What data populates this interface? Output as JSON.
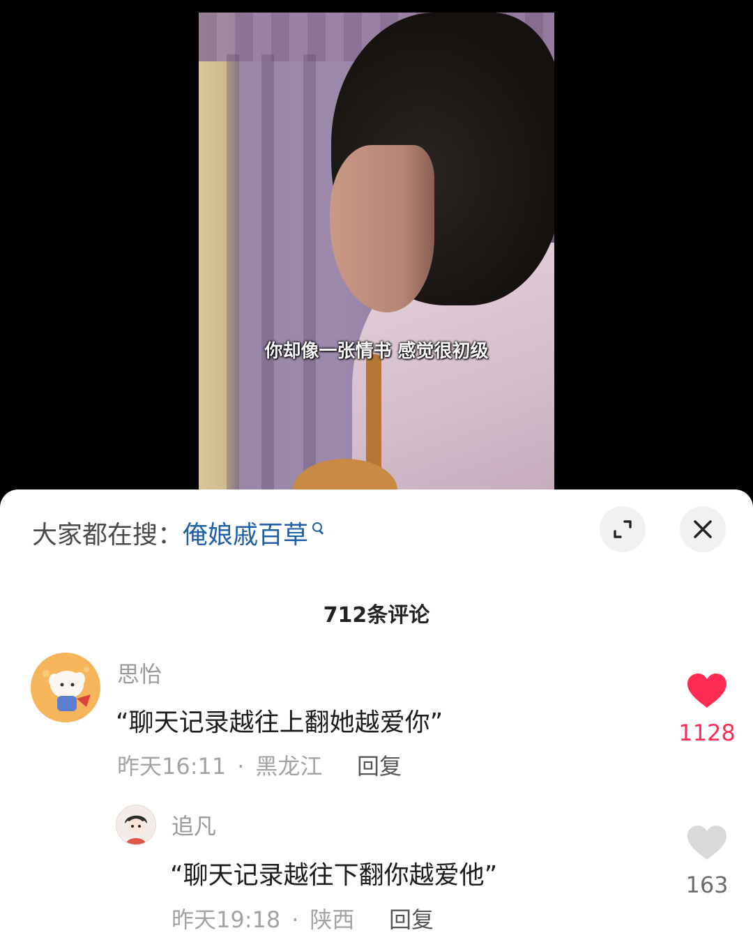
{
  "video": {
    "subtitle": "你却像一张情书 感觉很初级"
  },
  "search": {
    "label": "大家都在搜：",
    "term": "俺娘戚百草"
  },
  "comments_header": {
    "count_label": "712条评论"
  },
  "comments": [
    {
      "user": "思怡",
      "text": "“聊天记录越往上翻她越爱你”",
      "time": "昨天16:11",
      "location": "黑龙江",
      "reply_label": "回复",
      "likes": "1128",
      "liked": true
    },
    {
      "user": "追凡",
      "text": "“聊天记录越往下翻你越爱他”",
      "time": "昨天19:18",
      "location": "陕西",
      "reply_label": "回复",
      "likes": "163",
      "liked": false
    }
  ],
  "colors": {
    "liked": "#fe2c55",
    "unliked": "#d9d9d9",
    "link": "#1f5fa8"
  },
  "icons": [
    "search-icon",
    "expand-icon",
    "close-icon",
    "heart-icon"
  ]
}
